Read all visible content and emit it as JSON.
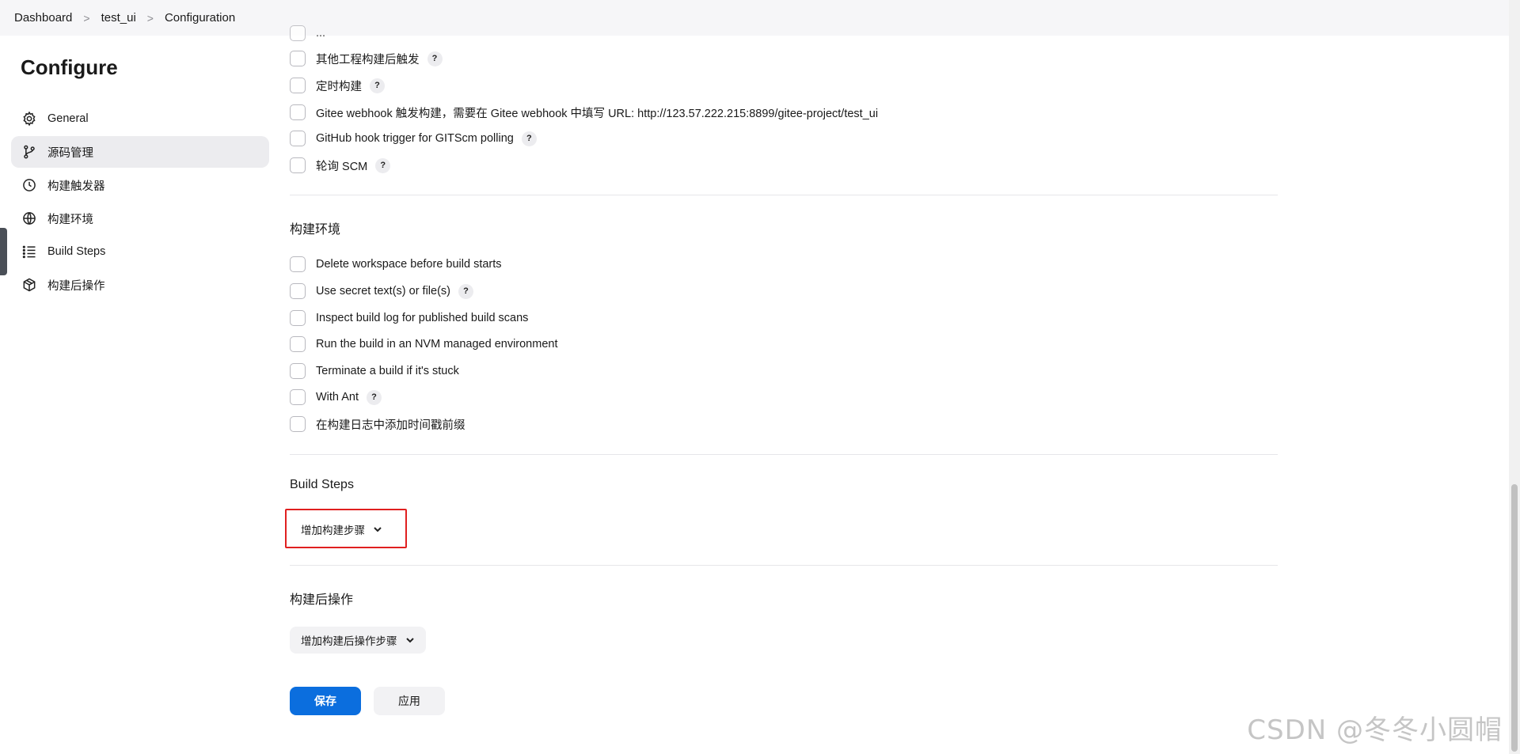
{
  "breadcrumb": {
    "items": [
      "Dashboard",
      "test_ui",
      "Configuration"
    ],
    "separator": ">"
  },
  "sidebar": {
    "title": "Configure",
    "items": [
      {
        "label": "General",
        "icon": "gear-icon"
      },
      {
        "label": "源码管理",
        "icon": "branch-icon",
        "active": true
      },
      {
        "label": "构建触发器",
        "icon": "clock-icon"
      },
      {
        "label": "构建环境",
        "icon": "globe-icon"
      },
      {
        "label": "Build Steps",
        "icon": "list-icon"
      },
      {
        "label": "构建后操作",
        "icon": "package-icon"
      }
    ]
  },
  "triggers": {
    "partial_label": "...",
    "items": [
      {
        "label": "其他工程构建后触发",
        "help": "?"
      },
      {
        "label": "定时构建",
        "help": "?"
      },
      {
        "label": "Gitee webhook 触发构建，需要在 Gitee webhook 中填写 URL: http://123.57.222.215:8899/gitee-project/test_ui"
      },
      {
        "label": "GitHub hook trigger for GITScm polling",
        "help": "?"
      },
      {
        "label": "轮询 SCM",
        "help": "?"
      }
    ]
  },
  "build_env": {
    "title": "构建环境",
    "items": [
      {
        "label": "Delete workspace before build starts"
      },
      {
        "label": "Use secret text(s) or file(s)",
        "help": "?"
      },
      {
        "label": "Inspect build log for published build scans"
      },
      {
        "label": "Run the build in an NVM managed environment"
      },
      {
        "label": "Terminate a build if it's stuck"
      },
      {
        "label": "With Ant",
        "help": "?"
      },
      {
        "label": "在构建日志中添加时间戳前缀"
      }
    ]
  },
  "build_steps": {
    "title": "Build Steps",
    "add_button": "增加构建步骤"
  },
  "post_build": {
    "title": "构建后操作",
    "add_button": "增加构建后操作步骤"
  },
  "actions": {
    "save": "保存",
    "apply": "应用"
  },
  "watermark": "CSDN @冬冬小圆帽",
  "colors": {
    "primary": "#0b6ede",
    "highlight": "#e02020",
    "active_bg": "#ececef"
  }
}
